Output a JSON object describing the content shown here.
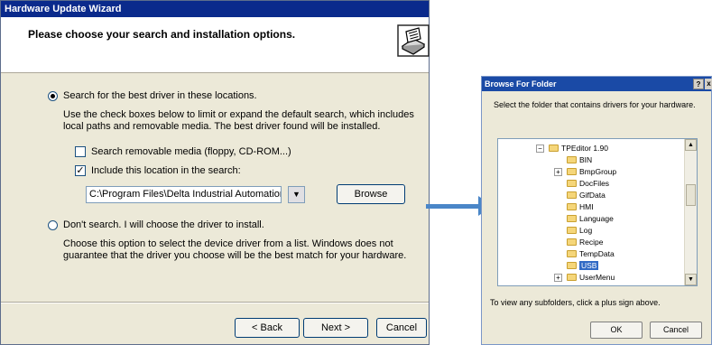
{
  "wizard": {
    "title": "Hardware Update Wizard",
    "header_title": "Please choose your search and installation options.",
    "option_search_label": "Search for the best driver in these locations.",
    "option_search_desc": "Use the check boxes below to limit or expand the default search, which includes local paths and removable media. The best driver found will be installed.",
    "removable_media_label": "Search removable media (floppy, CD-ROM...)",
    "include_location_label": "Include this location in the search:",
    "location_value": "C:\\Program Files\\Delta Industrial Automation\\TPEdit",
    "browse_label": "Browse",
    "option_dont_search_label": "Don't search. I will choose the driver to install.",
    "option_dont_search_desc": "Choose this option to select the device driver from a list.  Windows does not guarantee that the driver you choose will be the best match for your hardware.",
    "back_label": "< Back",
    "next_label": "Next >",
    "cancel_label": "Cancel",
    "search_option_selected": true,
    "removable_media_checked": false,
    "include_location_checked": true
  },
  "browse_dialog": {
    "title": "Browse For Folder",
    "help_label": "?",
    "close_label": "x",
    "instruction": "Select the folder that contains drivers for your hardware.",
    "tree": [
      {
        "label": "TPEditor 1.90",
        "expander": "−",
        "level": 0
      },
      {
        "label": "BIN",
        "expander": "",
        "level": 1
      },
      {
        "label": "BmpGroup",
        "expander": "+",
        "level": 1
      },
      {
        "label": "DocFiles",
        "expander": "",
        "level": 1
      },
      {
        "label": "GifData",
        "expander": "",
        "level": 1
      },
      {
        "label": "HMI",
        "expander": "",
        "level": 1
      },
      {
        "label": "Language",
        "expander": "",
        "level": 1
      },
      {
        "label": "Log",
        "expander": "",
        "level": 1
      },
      {
        "label": "Recipe",
        "expander": "",
        "level": 1
      },
      {
        "label": "TempData",
        "expander": "",
        "level": 1
      },
      {
        "label": "USB",
        "expander": "",
        "level": 1,
        "selected": true
      },
      {
        "label": "UserMenu",
        "expander": "+",
        "level": 1
      }
    ],
    "hint": "To view any subfolders, click a plus sign above.",
    "ok_label": "OK",
    "cancel_label": "Cancel"
  },
  "colors": {
    "titlebar": "#0a2a8c",
    "dialog_bg": "#ece9d8",
    "arrow": "#4a86c8",
    "selection": "#316ac5"
  }
}
